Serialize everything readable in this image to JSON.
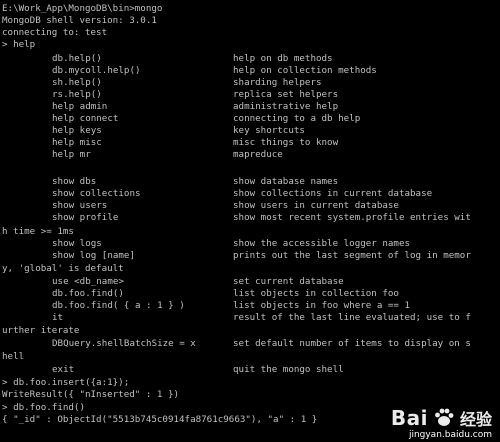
{
  "console": {
    "lines": [
      "E:\\Work_App\\MongoDB\\bin>mongo",
      "MongoDB shell version: 3.0.1",
      "connecting to: test",
      "> help"
    ],
    "help": [
      {
        "cmd": "db.help()",
        "desc": "help on db methods"
      },
      {
        "cmd": "db.mycoll.help()",
        "desc": "help on collection methods"
      },
      {
        "cmd": "sh.help()",
        "desc": "sharding helpers"
      },
      {
        "cmd": "rs.help()",
        "desc": "replica set helpers"
      },
      {
        "cmd": "help admin",
        "desc": "administrative help"
      },
      {
        "cmd": "help connect",
        "desc": "connecting to a db help"
      },
      {
        "cmd": "help keys",
        "desc": "key shortcuts"
      },
      {
        "cmd": "help misc",
        "desc": "misc things to know"
      },
      {
        "cmd": "help mr",
        "desc": "mapreduce"
      },
      {
        "cmd": "show dbs",
        "desc": "show database names"
      },
      {
        "cmd": "show collections",
        "desc": "show collections in current database"
      },
      {
        "cmd": "show users",
        "desc": "show users in current database"
      },
      {
        "cmd": "show profile",
        "desc": "show most recent system.profile entries wit"
      },
      {
        "cmd": "show logs",
        "desc": "show the accessible logger names"
      },
      {
        "cmd": "show log [name]",
        "desc": "prints out the last segment of log in memor"
      },
      {
        "cmd": "use <db_name>",
        "desc": "set current database"
      },
      {
        "cmd": "db.foo.find()",
        "desc": "list objects in collection foo"
      },
      {
        "cmd": "db.foo.find( { a : 1 } )",
        "desc": "list objects in foo where a == 1"
      },
      {
        "cmd": "it",
        "desc": "result of the last line evaluated; use to f"
      },
      {
        "cmd": "DBQuery.shellBatchSize = x",
        "desc": "set default number of items to display on s"
      },
      {
        "cmd": "exit",
        "desc": "quit the mongo shell"
      }
    ],
    "wraps": {
      "profile": "h time >= 1ms",
      "log": "y, 'global' is default",
      "it": "urther iterate",
      "batch": "hell"
    },
    "tail": [
      "> db.foo.insert({a:1});",
      "WriteResult({ \"nInserted\" : 1 })",
      "> db.foo.find()",
      "{ \"_id\" : ObjectId(\"5513b745c0914fa8761c9663\"), \"a\" : 1 }"
    ]
  },
  "watermark": {
    "logo_text": "Bai",
    "logo_text2": "经验",
    "url": "jingyan.baidu.com"
  },
  "colors": {
    "background": "#000000",
    "text": "#c0c0c0"
  }
}
